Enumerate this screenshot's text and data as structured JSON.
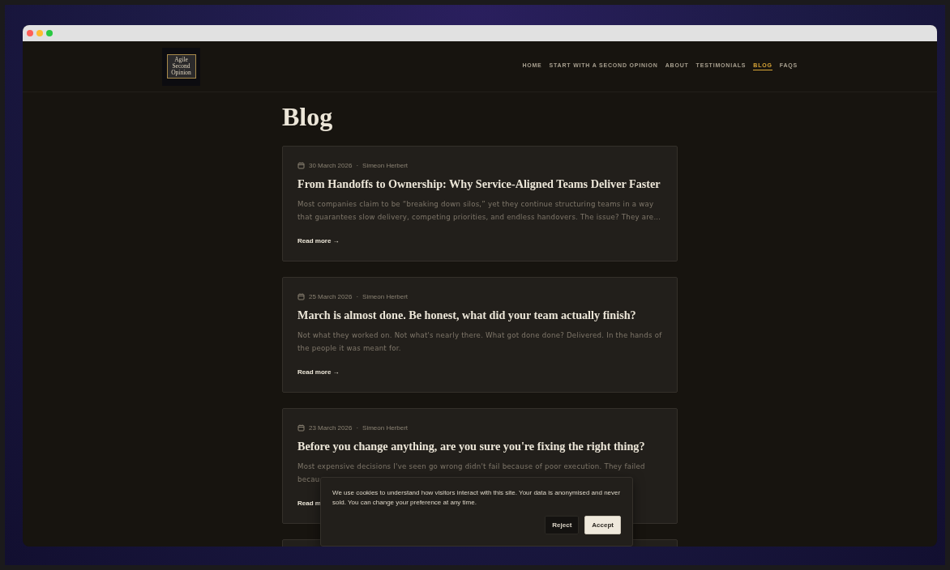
{
  "logo": {
    "text": "Agile Second Opinion"
  },
  "nav": [
    {
      "label": "HOME",
      "selected": false
    },
    {
      "label": "START WITH A SECOND OPINION",
      "selected": false
    },
    {
      "label": "ABOUT",
      "selected": false
    },
    {
      "label": "TESTIMONIALS",
      "selected": false
    },
    {
      "label": "BLOG",
      "selected": true
    },
    {
      "label": "FAQS",
      "selected": false
    }
  ],
  "heading": "Blog",
  "posts": [
    {
      "date": "30 March 2026",
      "separator": "·",
      "author": "Simeon Herbert",
      "title": "From Handoffs to Ownership: Why Service-Aligned Teams Deliver Faster",
      "excerpt": "Most companies claim to be “breaking down silos,” yet they continue structuring teams in a way that guarantees slow delivery, competing priorities, and endless handovers. The issue? They are...",
      "read_more": "Read more →"
    },
    {
      "date": "25 March 2026",
      "separator": "·",
      "author": "Simeon Herbert",
      "title": "March is almost done. Be honest, what did your team actually finish?",
      "excerpt": "Not what they worked on. Not what's nearly there. What got done done? Delivered. In the hands of the people it was meant for.",
      "read_more": "Read more →"
    },
    {
      "date": "23 March 2026",
      "separator": "·",
      "author": "Simeon Herbert",
      "title": "Before you change anything, are you sure you're fixing the right thing?",
      "excerpt": "Most expensive decisions I've seen go wrong didn't fail because of poor execution. They failed becau",
      "read_more": "Read m"
    }
  ],
  "cookie_banner": {
    "message": "We use cookies to understand how visitors interact with this site. Your data is anonymised and never sold. You can change your preference at any time.",
    "buttons": [
      {
        "label": "Reject",
        "kind": "secondary"
      },
      {
        "label": "Accept",
        "kind": "primary"
      }
    ]
  }
}
